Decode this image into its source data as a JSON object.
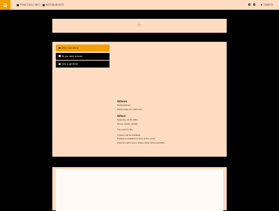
{
  "topbar": {
    "nav": [
      {
        "label": "PRACTICAL INFO",
        "icon": "square-icon"
      },
      {
        "label": "RESTAURANTS",
        "icon": "square-icon"
      }
    ],
    "languages": [
      "language-flag-icon",
      "language-flag-icon"
    ],
    "tickets_label": "TICKETS"
  },
  "header": {
    "icon": "loading-icon"
  },
  "tabs": [
    {
      "label": "When and where",
      "active": true
    },
    {
      "label": "All you need to know",
      "active": false
    },
    {
      "label": "How to get there",
      "active": false
    }
  ],
  "info": {
    "where_heading": "Where",
    "where_lines": [
      "Esplanadenet",
      "Wednesday 14, 2016 Gen"
    ],
    "when_heading": "When",
    "when_lines": [
      "Saturday, 14.01.2016",
      "Doors: 19:00 - 00h30"
    ],
    "extra_lines": [
      "The event is 18+",
      "Lockers will be available",
      "Parking is available in front of the venue",
      "Payment with card or Eaton-ticket will be possible"
    ]
  },
  "colors": {
    "accent": "#f5a000",
    "panel": "#fddcc2",
    "background": "#000000"
  }
}
